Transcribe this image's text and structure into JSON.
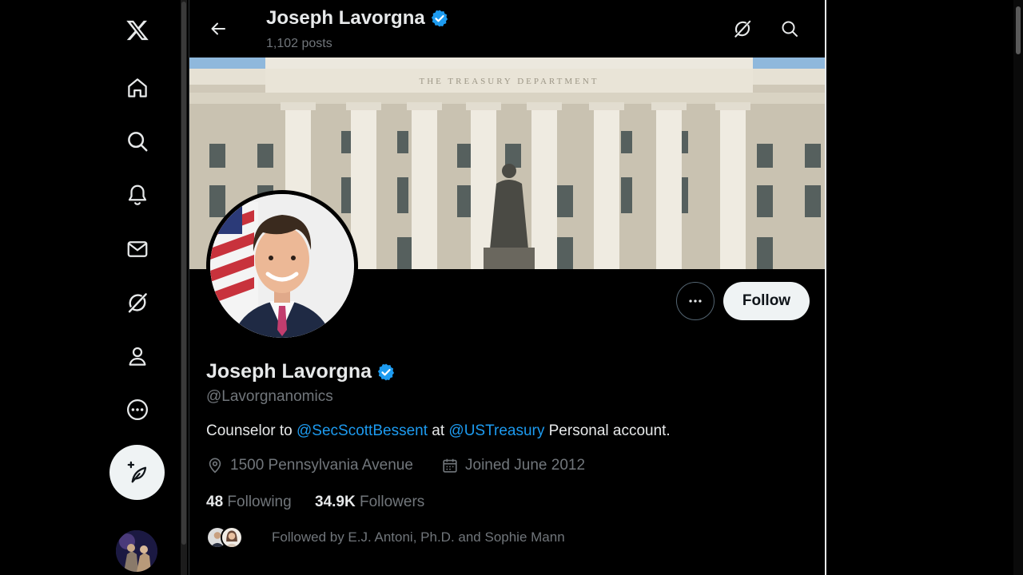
{
  "app": {
    "logo": "x-logo-icon"
  },
  "nav": {
    "items": [
      {
        "icon": "home-icon"
      },
      {
        "icon": "search-icon"
      },
      {
        "icon": "notifications-bell-icon"
      },
      {
        "icon": "messages-envelope-icon"
      },
      {
        "icon": "grok-icon"
      },
      {
        "icon": "profile-person-icon"
      },
      {
        "icon": "more-circle-icon"
      }
    ],
    "compose_icon": "compose-feather-icon"
  },
  "header": {
    "name": "Joseph Lavorgna",
    "posts": "1,102 posts"
  },
  "profile": {
    "display_name": "Joseph Lavorgna",
    "handle": "@Lavorgnanomics",
    "bio_prefix": "Counselor to ",
    "bio_mention1": "@SecScottBessent",
    "bio_middle": " at ",
    "bio_mention2": "@USTreasury",
    "bio_suffix": " Personal account.",
    "location": "1500 Pennsylvania Avenue",
    "joined": "Joined June 2012",
    "following_count": "48",
    "following_label": "Following",
    "followers_count": "34.9K",
    "followers_label": "Followers",
    "followed_by": "Followed by E.J. Antoni, Ph.D. and Sophie Mann",
    "follow_label": "Follow",
    "banner_inscription": "THE TREASURY DEPARTMENT"
  },
  "colors": {
    "accent": "#1d9bf0",
    "background": "#000000",
    "text": "#e7e9ea",
    "muted": "#71767b"
  }
}
